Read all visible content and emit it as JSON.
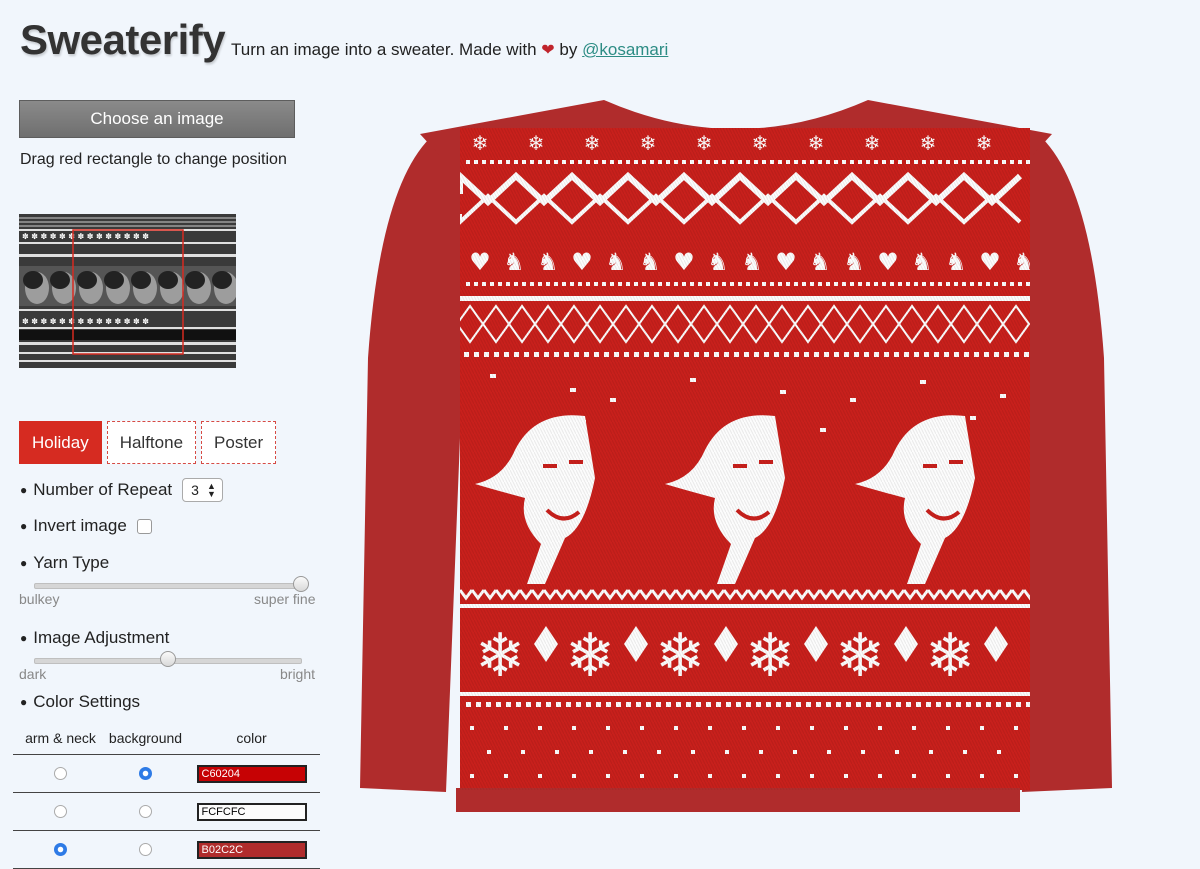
{
  "header": {
    "title": "Sweaterify",
    "tagline_prefix": "Turn an image into a sweater. Made with",
    "tagline_by": "by",
    "author_link": "@kosamari"
  },
  "sidebar": {
    "choose_button": "Choose an image",
    "drag_hint": "Drag red rectangle to change position",
    "tabs": [
      {
        "label": "Holiday",
        "active": true
      },
      {
        "label": "Halftone",
        "active": false
      },
      {
        "label": "Poster",
        "active": false
      }
    ],
    "repeat_label": "Number of Repeat",
    "repeat_value": "3",
    "invert_label": "Invert image",
    "invert_checked": false,
    "yarn_label": "Yarn Type",
    "yarn_min": "bulkey",
    "yarn_max": "super fine",
    "yarn_value": 1.0,
    "adjust_label": "Image Adjustment",
    "adjust_min": "dark",
    "adjust_max": "bright",
    "adjust_value": 0.5,
    "color_label": "Color Settings"
  },
  "colors": {
    "headers": [
      "arm & neck",
      "background",
      "color"
    ],
    "rows": [
      {
        "arm": false,
        "background": true,
        "value": "C60204",
        "hex": "#c60204"
      },
      {
        "arm": false,
        "background": false,
        "value": "FCFCFC",
        "hex": "#fcfcfc"
      },
      {
        "arm": true,
        "background": false,
        "value": "B02C2C",
        "hex": "#b02c2c"
      }
    ]
  },
  "sweater": {
    "body_color": "#c8201c",
    "arm_color": "#b02c2c",
    "pattern_color": "#fcfcfc",
    "repeat": 3
  }
}
